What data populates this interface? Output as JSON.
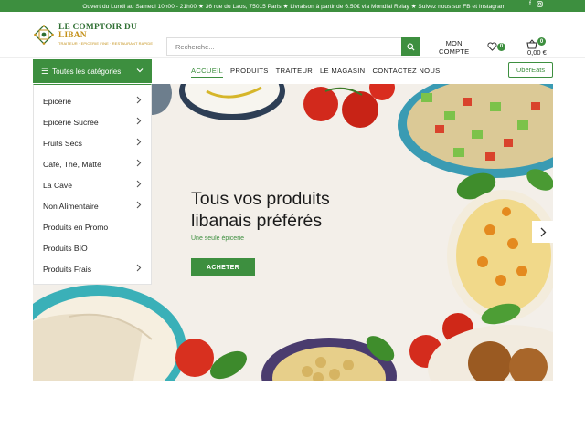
{
  "topbar": {
    "message": "| Ouvert du Lundi au Samedi 10h00 - 21h00 ★ 36 rue du Laos, 75015 Paris ★ Livraison à partir de 6.50€ via Mondial Relay ★ Suivez nous sur FB et Instagram",
    "social_icons": [
      "facebook-icon",
      "instagram-icon"
    ]
  },
  "logo": {
    "title_part1": "LE COMPTOIR DU",
    "title_part2": "LIBAN",
    "subtitle": "TRAITEUR · EPICERIE FINE · RESTAURANT RAPIDE"
  },
  "search": {
    "placeholder": "Recherche...",
    "icon": "search-icon"
  },
  "account": {
    "line1": "MON",
    "line2": "COMPTE"
  },
  "wishlist": {
    "count": "0",
    "icon": "heart-icon"
  },
  "cart": {
    "count": "0",
    "total": "0,00 €",
    "icon": "basket-icon"
  },
  "categories_button": {
    "label": "Toutes les catégories"
  },
  "categories": [
    {
      "label": "Epicerie",
      "has_sub": true
    },
    {
      "label": "Epicerie Sucrée",
      "has_sub": true
    },
    {
      "label": "Fruits Secs",
      "has_sub": true
    },
    {
      "label": "Café, Thé, Matté",
      "has_sub": true
    },
    {
      "label": "La Cave",
      "has_sub": true
    },
    {
      "label": "Non Alimentaire",
      "has_sub": true
    },
    {
      "label": "Produits en Promo",
      "has_sub": false
    },
    {
      "label": "Produits BIO",
      "has_sub": false
    },
    {
      "label": "Produits Frais",
      "has_sub": true
    }
  ],
  "menu": [
    {
      "label": "ACCUEIL",
      "active": true
    },
    {
      "label": "PRODUITS"
    },
    {
      "label": "TRAITEUR"
    },
    {
      "label": "LE MAGASIN"
    },
    {
      "label": "CONTACTEZ NOUS"
    }
  ],
  "ubereats": {
    "label": "UberEats"
  },
  "hero": {
    "title_line1": "Tous vos produits",
    "title_line2": "libanais préférés",
    "subtitle": "Une seule épicerie",
    "button": "ACHETER"
  },
  "colors": {
    "brand_green": "#3d8f3f",
    "gold": "#c4911a"
  }
}
